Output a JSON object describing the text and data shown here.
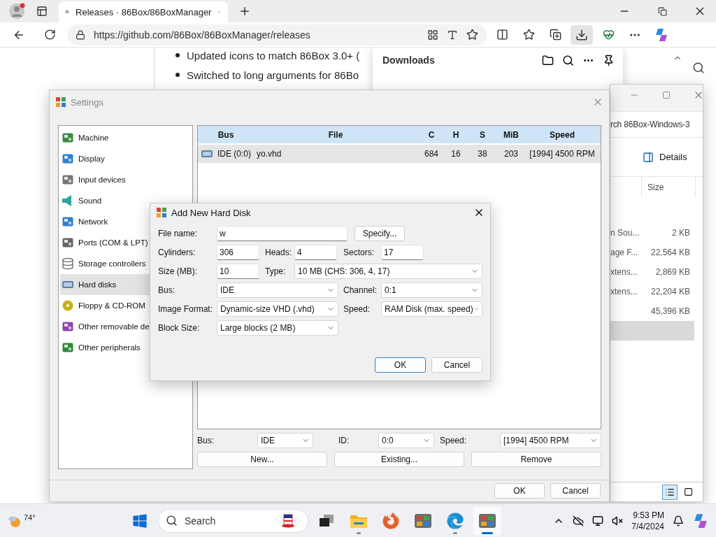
{
  "browser": {
    "tab_title": "Releases · 86Box/86BoxManager",
    "url": "https://github.com/86Box/86BoxManager/releases",
    "page_bullets": [
      "Updated icons to match 86Box 3.0+ (",
      "Switched to long arguments for 86Bo"
    ]
  },
  "downloads": {
    "title": "Downloads"
  },
  "explorer": {
    "search": "rch 86Box-Windows-3",
    "view_button": "Details",
    "columns": [
      "Size"
    ],
    "rows": [
      {
        "name": "n Sou...",
        "size": "2 KB",
        "selected": false
      },
      {
        "name": "age F...",
        "size": "22,564 KB",
        "selected": false
      },
      {
        "name": "xtens...",
        "size": "2,869 KB",
        "selected": false
      },
      {
        "name": "xtens...",
        "size": "22,204 KB",
        "selected": false
      },
      {
        "size": "45,396 KB",
        "selected": false
      },
      {
        "selected": true
      }
    ]
  },
  "settings": {
    "title": "Settings",
    "categories": [
      {
        "label": "Machine",
        "selected": false
      },
      {
        "label": "Display",
        "selected": false
      },
      {
        "label": "Input devices",
        "selected": false
      },
      {
        "label": "Sound",
        "selected": false
      },
      {
        "label": "Network",
        "selected": false
      },
      {
        "label": "Ports (COM & LPT)",
        "selected": false
      },
      {
        "label": "Storage controllers",
        "selected": false
      },
      {
        "label": "Hard disks",
        "selected": true
      },
      {
        "label": "Floppy & CD-ROM",
        "selected": false
      },
      {
        "label": "Other removable de",
        "selected": false
      },
      {
        "label": "Other peripherals",
        "selected": false
      }
    ],
    "table": {
      "columns": [
        "Bus",
        "File",
        "C",
        "H",
        "S",
        "MiB",
        "Speed"
      ],
      "rows": [
        {
          "cells": [
            "IDE (0:0)",
            "yo.vhd",
            "684",
            "16",
            "38",
            "203",
            "[1994] 4500 RPM"
          ],
          "selected": true
        }
      ]
    },
    "bus": {
      "label": "Bus:",
      "value": "IDE"
    },
    "id": {
      "label": "ID:",
      "value": "0:0"
    },
    "speed": {
      "label": "Speed:",
      "value": "[1994] 4500 RPM"
    },
    "disk_buttons": [
      "New...",
      "Existing...",
      "Remove"
    ],
    "buttons": [
      {
        "label": "OK",
        "default": false
      },
      {
        "label": "Cancel",
        "default": false
      }
    ]
  },
  "dialog": {
    "title": "Add New Hard Disk",
    "file_name": {
      "label": "File name:",
      "value": "w"
    },
    "specify_button": "Specify...",
    "cylinders": {
      "label": "Cylinders:",
      "value": "306"
    },
    "heads": {
      "label": "Heads:",
      "value": "4"
    },
    "sectors": {
      "label": "Sectors:",
      "value": "17"
    },
    "size": {
      "label": "Size (MB):",
      "value": "10"
    },
    "type": {
      "label": "Type:",
      "value": "10 MB (CHS: 306, 4, 17)"
    },
    "bus": {
      "label": "Bus:",
      "value": "IDE"
    },
    "channel": {
      "label": "Channel:",
      "value": "0:1"
    },
    "image_format": {
      "label": "Image Format:",
      "value": "Dynamic-size VHD (.vhd)"
    },
    "speed": {
      "label": "Speed:",
      "value": "RAM Disk (max. speed)"
    },
    "block_size": {
      "label": "Block Size:",
      "value": "Large blocks (2 MB)"
    },
    "buttons": [
      {
        "label": "OK",
        "default": true
      },
      {
        "label": "Cancel",
        "default": false
      }
    ]
  },
  "taskbar": {
    "weather": "74°",
    "search_placeholder": "Search",
    "apps": [
      {
        "running": false,
        "selected": false
      },
      {
        "running": true,
        "selected": false
      },
      {
        "running": false,
        "selected": false
      },
      {
        "running": false,
        "selected": false
      },
      {
        "running": true,
        "selected": false
      },
      {
        "running": true,
        "selected": true
      }
    ],
    "time": "9:53 PM",
    "date": "7/4/2024"
  }
}
